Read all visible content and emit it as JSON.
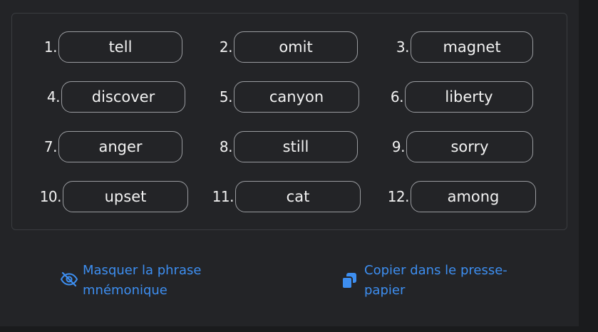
{
  "words": [
    {
      "num": "1.",
      "word": "tell"
    },
    {
      "num": "2.",
      "word": "omit"
    },
    {
      "num": "3.",
      "word": "magnet"
    },
    {
      "num": "4.",
      "word": "discover"
    },
    {
      "num": "5.",
      "word": "canyon"
    },
    {
      "num": "6.",
      "word": "liberty"
    },
    {
      "num": "7.",
      "word": "anger"
    },
    {
      "num": "8.",
      "word": "still"
    },
    {
      "num": "9.",
      "word": "sorry"
    },
    {
      "num": "10.",
      "word": "upset"
    },
    {
      "num": "11.",
      "word": "cat"
    },
    {
      "num": "12.",
      "word": "among"
    }
  ],
  "actions": {
    "hide_label_line1": "Masquer la phrase",
    "hide_label_line2": "mnémonique",
    "hide_icon": "eye-slash-icon",
    "copy_label_line1": "Copier dans le presse-",
    "copy_label_line2": "papier",
    "copy_icon": "copy-icon"
  },
  "colors": {
    "accent": "#3d8ef0",
    "text": "#f2f2f2",
    "background": "#232427"
  }
}
